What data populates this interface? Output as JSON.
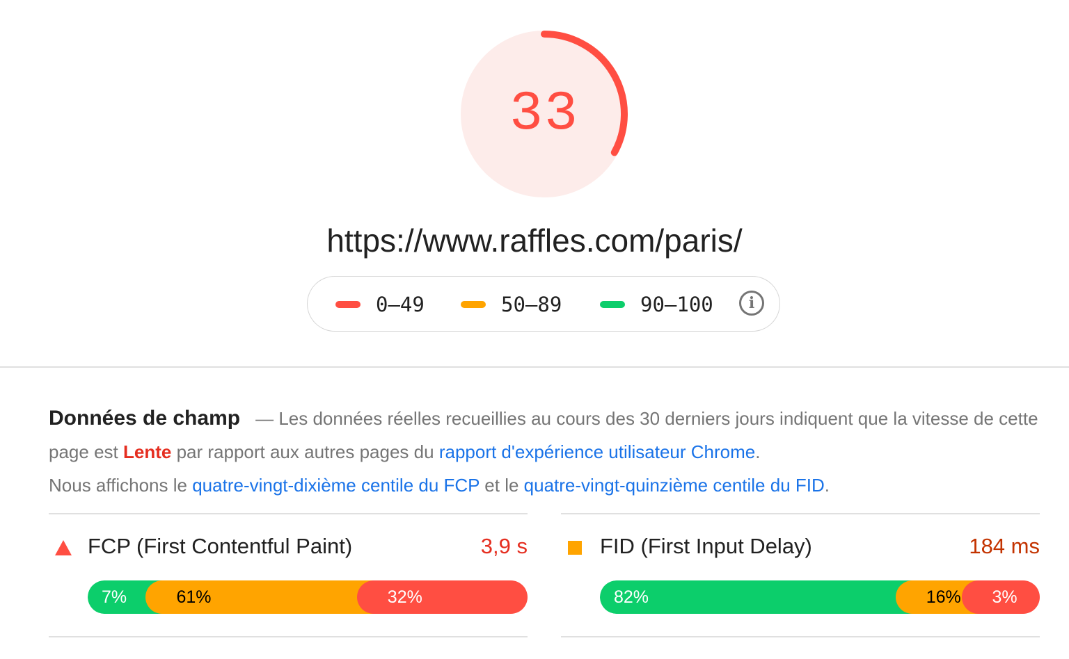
{
  "score": {
    "value": "33",
    "fraction": 0.33,
    "arc_color": "#ff4e42",
    "bg_color": "#fdecea"
  },
  "url": "https://www.raffles.com/paris/",
  "legend": {
    "items": [
      {
        "label": "0–49",
        "color": "#ff4e42"
      },
      {
        "label": "50–89",
        "color": "#ffa400"
      },
      {
        "label": "90–100",
        "color": "#0cce6b"
      }
    ],
    "info_icon": "info-icon"
  },
  "field_data": {
    "title": "Données de champ",
    "dash": "—",
    "text1": "Les données réelles recueillies au cours des 30 derniers jours indiquent que la vitesse de cette page est",
    "speed": "Lente",
    "text2": "par rapport aux autres pages du",
    "link1": "rapport d'expérience utilisateur Chrome",
    "text3": ".",
    "text4": "Nous affichons le",
    "link2": "quatre-vingt-dixième centile du FCP",
    "text5": "et le",
    "link3": "quatre-vingt-quinzième centile du FID",
    "text6": "."
  },
  "metrics": [
    {
      "name": "FCP (First Contentful Paint)",
      "value": "3,9 s",
      "value_color": "#e52e20",
      "icon": "triangle-icon",
      "segments": [
        {
          "label": "7%",
          "percent": 17,
          "color": "#0cce6b",
          "text_color": "#ffffff"
        },
        {
          "label": "61%",
          "percent": 48,
          "color": "#ffa400",
          "text_color": "#000000"
        },
        {
          "label": "32%",
          "percent": 35,
          "color": "#ff4e42",
          "text_color": "#ffffff"
        }
      ]
    },
    {
      "name": "FID (First Input Delay)",
      "value": "184 ms",
      "value_color": "#c33300",
      "icon": "square-icon",
      "segments": [
        {
          "label": "82%",
          "percent": 71,
          "color": "#0cce6b",
          "text_color": "#ffffff"
        },
        {
          "label": "16%",
          "percent": 15,
          "color": "#ffa400",
          "text_color": "#000000"
        },
        {
          "label": "3%",
          "percent": 14,
          "color": "#ff4e42",
          "text_color": "#ffffff"
        }
      ]
    }
  ]
}
